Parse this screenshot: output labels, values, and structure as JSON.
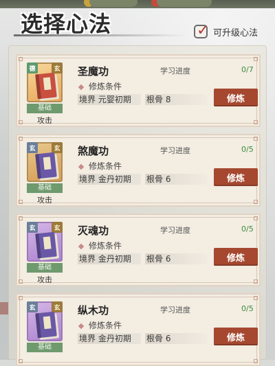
{
  "header": {
    "title": "选择心法",
    "filter_label": "可升级心法",
    "filter_checked": true
  },
  "skills": [
    {
      "name": "圣魔功",
      "progress_label": "学习进度",
      "progress_value": "0/7",
      "cond_title": "修炼条件",
      "realm": "境界 元婴初期",
      "bone": "根骨 8",
      "level": "基础",
      "type": "攻击",
      "button": "修炼",
      "book_color": "red"
    },
    {
      "name": "煞魔功",
      "progress_label": "学习进度",
      "progress_value": "0/5",
      "cond_title": "修炼条件",
      "realm": "境界 金丹初期",
      "bone": "根骨 6",
      "level": "基础",
      "type": "攻击",
      "button": "修炼",
      "book_color": "purple"
    },
    {
      "name": "灭魂功",
      "progress_label": "学习进度",
      "progress_value": "0/5",
      "cond_title": "修炼条件",
      "realm": "境界 金丹初期",
      "bone": "根骨 6",
      "level": "基础",
      "type": "攻击",
      "button": "修炼",
      "book_color": "purple"
    },
    {
      "name": "纵木功",
      "progress_label": "学习进度",
      "progress_value": "0/5",
      "cond_title": "修炼条件",
      "realm": "境界 金丹初期",
      "bone": "根骨 6",
      "level": "基础",
      "type": "",
      "button": "修炼",
      "book_color": "purple"
    }
  ]
}
